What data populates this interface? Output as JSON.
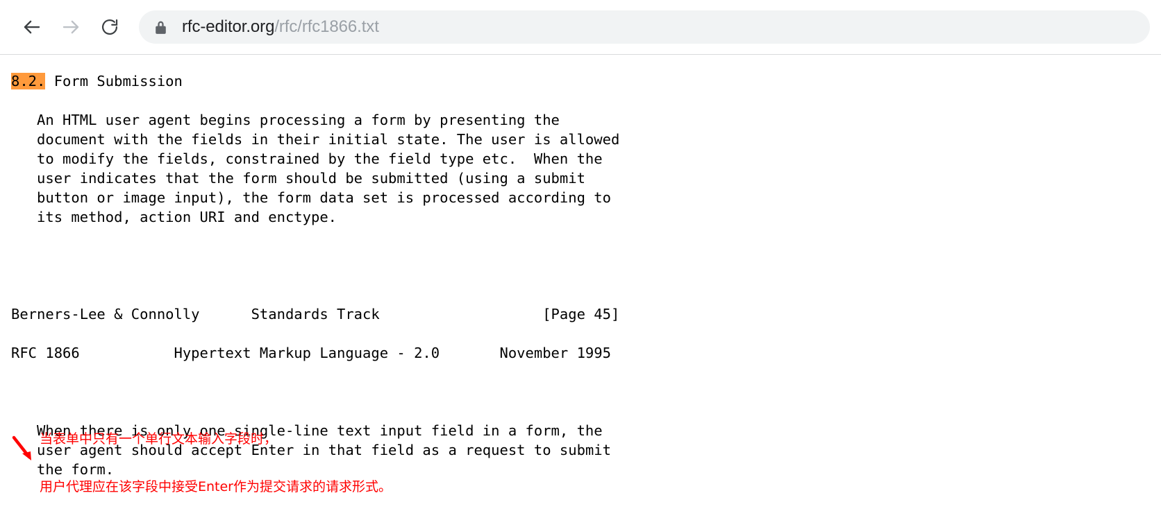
{
  "browser": {
    "back_icon": "arrow-left-icon",
    "forward_icon": "arrow-right-icon",
    "reload_icon": "reload-icon",
    "lock_icon": "lock-icon",
    "url_domain": "rfc-editor.org",
    "url_path": "/rfc/rfc1866.txt",
    "url_full": "rfc-editor.org/rfc/rfc1866.txt",
    "colors": {
      "omnibox_bg": "#f1f3f4",
      "domain_text": "#202124",
      "path_text": "#9aa0a6",
      "back_enabled": "#3c4043",
      "forward_disabled": "#bdc1c6"
    }
  },
  "document": {
    "heading": {
      "highlight": "8.2.",
      "highlight_color": "#ff9a3c",
      "title": " Form Submission"
    },
    "paragraph_1": [
      "   An HTML user agent begins processing a form by presenting the",
      "   document with the fields in their initial state. The user is allowed",
      "   to modify the fields, constrained by the field type etc.  When the",
      "   user indicates that the form should be submitted (using a submit",
      "   button or image input), the form data set is processed according to",
      "   its method, action URI and enctype."
    ],
    "page_footer": "Berners-Lee & Connolly      Standards Track                   [Page 45]",
    "page_header": "RFC 1866           Hypertext Markup Language - 2.0       November 1995",
    "paragraph_2": [
      "   When there is only one single-line text input field in a form, the",
      "   user agent should accept Enter in that field as a request to submit",
      "   the form."
    ]
  },
  "annotation": {
    "color": "#ff0000",
    "lines": [
      "当表单中只有一个单行文本输入字段时，",
      "用户代理应在该字段中接受Enter作为提交请求的请求形式。"
    ],
    "arrow_icon": "arrow-down-right-icon"
  }
}
